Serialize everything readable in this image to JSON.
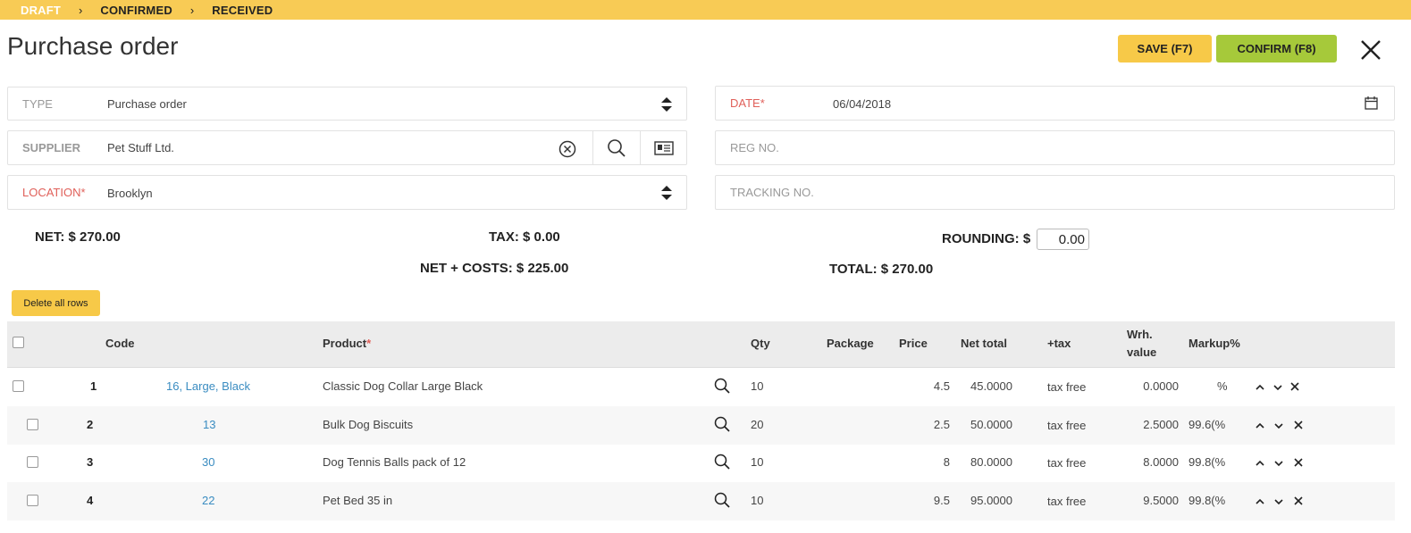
{
  "workflow": {
    "steps": [
      "DRAFT",
      "CONFIRMED",
      "RECEIVED"
    ],
    "separator": "›"
  },
  "page": {
    "title": "Purchase order"
  },
  "actions": {
    "save": "SAVE (F7)",
    "confirm": "CONFIRM (F8)"
  },
  "form": {
    "type": {
      "label": "TYPE",
      "value": "Purchase order"
    },
    "supplier": {
      "label": "SUPPLIER",
      "value": "Pet Stuff Ltd."
    },
    "location": {
      "label": "LOCATION",
      "value": "Brooklyn"
    },
    "date": {
      "label": "DATE",
      "value": "06/04/2018"
    },
    "reg_no": {
      "label": "REG NO.",
      "value": ""
    },
    "tracking_no": {
      "label": "TRACKING NO.",
      "value": ""
    },
    "required_mark": "*"
  },
  "totals": {
    "net": "NET: $ 270.00",
    "tax": "TAX: $ 0.00",
    "net_costs": "NET + COSTS: $ 225.00",
    "rounding_label": "ROUNDING: $",
    "rounding_value": "0.00",
    "total": "TOTAL: $ 270.00"
  },
  "table": {
    "delete_all": "Delete all rows",
    "headers": {
      "code": "Code",
      "product": "Product",
      "qty": "Qty",
      "package": "Package",
      "price": "Price",
      "net_total": "Net total",
      "tax": "+tax",
      "wrh_value_1": "Wrh.",
      "wrh_value_2": "value",
      "markup": "Markup%"
    },
    "rows": [
      {
        "num": "1",
        "code": "16, Large, Black",
        "product": "Classic Dog Collar Large Black",
        "qty": "10",
        "price": "4.5",
        "net_total": "45.0000",
        "tax": "tax free",
        "wrh_value": "0.0000",
        "markup": "%"
      },
      {
        "num": "2",
        "code": "13",
        "product": "Bulk Dog Biscuits",
        "qty": "20",
        "price": "2.5",
        "net_total": "50.0000",
        "tax": "tax free",
        "wrh_value": "2.5000",
        "markup": "99.6(%"
      },
      {
        "num": "3",
        "code": "30",
        "product": "Dog Tennis Balls pack of 12",
        "qty": "10",
        "price": "8",
        "net_total": "80.0000",
        "tax": "tax free",
        "wrh_value": "8.0000",
        "markup": "99.8(%"
      },
      {
        "num": "4",
        "code": "22",
        "product": "Pet Bed 35 in",
        "qty": "10",
        "price": "9.5",
        "net_total": "95.0000",
        "tax": "tax free",
        "wrh_value": "9.5000",
        "markup": "99.8(%"
      }
    ]
  },
  "colors": {
    "status_bar": "#f8cb55",
    "save": "#f7c948",
    "confirm": "#a6c93a",
    "required": "#e0605a",
    "link": "#3a8cc1"
  },
  "icons": [
    "close-icon",
    "select-arrows-icon",
    "clear-icon",
    "search-icon",
    "id-card-icon",
    "calendar-icon",
    "move-up-icon",
    "move-down-icon",
    "delete-row-icon"
  ]
}
